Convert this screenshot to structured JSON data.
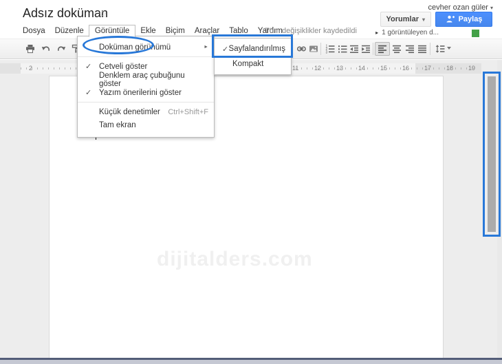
{
  "app": {
    "account_name": "cevher ozan güler",
    "save_status": "Tüm değişiklikler kaydedildi",
    "viewers": "1 görüntüleyen d..."
  },
  "doc": {
    "title": "Adsız doküman",
    "watermark": "dijitalders.com"
  },
  "buttons": {
    "comments": "Yorumlar",
    "share": "Paylaş"
  },
  "menubar": {
    "items": [
      "Dosya",
      "Düzenle",
      "Görüntüle",
      "Ekle",
      "Biçim",
      "Araçlar",
      "Tablo",
      "Yardım"
    ]
  },
  "view_menu": {
    "items": [
      {
        "label": "Doküman görünümü",
        "has_submenu": true,
        "annotated": true
      },
      {
        "label": "Cetveli göster",
        "checked": true
      },
      {
        "label": "Denklem araç çubuğunu göster",
        "checked": false
      },
      {
        "label": "Yazım önerilerini göster",
        "checked": true
      },
      {
        "label": "Küçük denetimler",
        "shortcut": "Ctrl+Shift+F"
      },
      {
        "label": "Tam ekran"
      }
    ]
  },
  "doc_view_submenu": {
    "items": [
      {
        "label": "Sayfalandırılmış",
        "checked": true,
        "annotated": true
      },
      {
        "label": "Kompakt",
        "checked": false
      }
    ]
  },
  "ruler": {
    "numbers": [
      "2",
      "11",
      "12",
      "13",
      "14",
      "15",
      "16",
      "17",
      "18",
      "19"
    ]
  },
  "icons": {
    "star": "☆",
    "check": "✓",
    "submenu_arrow": "►",
    "dropdown_arrow": "▾",
    "viewer_arrow": "▸"
  },
  "colors": {
    "annotation_blue": "#2878d8",
    "share_button_blue": "#4d90fe",
    "viewer_green": "#43a047"
  }
}
